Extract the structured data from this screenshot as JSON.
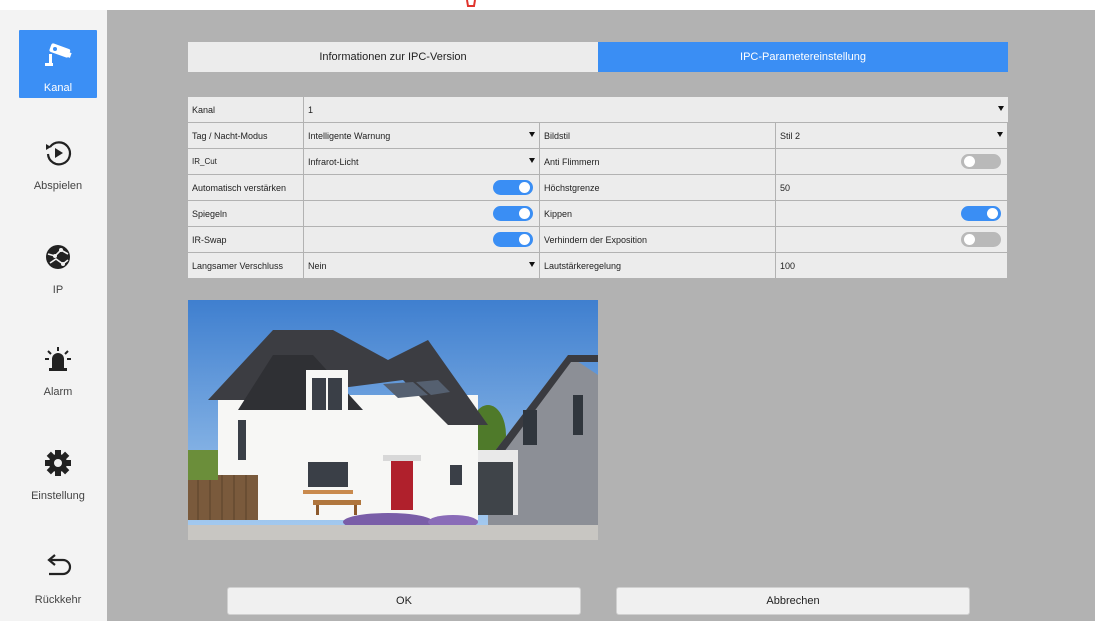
{
  "sidebar": {
    "items": [
      {
        "label": "Kanal",
        "icon": "camera-icon",
        "active": true
      },
      {
        "label": "Abspielen",
        "icon": "replay-icon",
        "active": false
      },
      {
        "label": "IP",
        "icon": "network-globe-icon",
        "active": false
      },
      {
        "label": "Alarm",
        "icon": "alarm-siren-icon",
        "active": false
      },
      {
        "label": "Einstellung",
        "icon": "gear-icon",
        "active": false
      },
      {
        "label": "Rückkehr",
        "icon": "back-arrow-icon",
        "active": false
      }
    ]
  },
  "tabs": [
    {
      "label": "Informationen zur IPC-Version",
      "active": false
    },
    {
      "label": "IPC-Parametereinstellung",
      "active": true
    }
  ],
  "settings": {
    "kanal": {
      "label": "Kanal",
      "value": "1"
    },
    "tag_nacht": {
      "label": "Tag / Nacht-Modus",
      "value": "Intelligente Warnung"
    },
    "bildstil": {
      "label": "Bildstil",
      "value": "Stil 2"
    },
    "ir_cut": {
      "label": "IR_Cut",
      "value": "Infrarot-Licht"
    },
    "anti_flimmern": {
      "label": "Anti Flimmern",
      "on": false
    },
    "auto_verstaerken": {
      "label": "Automatisch verstärken",
      "on": true
    },
    "hoechstgrenze": {
      "label": "Höchstgrenze",
      "value": "50"
    },
    "spiegeln": {
      "label": "Spiegeln",
      "on": true
    },
    "kippen": {
      "label": "Kippen",
      "on": true
    },
    "ir_swap": {
      "label": "IR-Swap",
      "on": true
    },
    "exposition": {
      "label": "Verhindern der Exposition",
      "on": false
    },
    "langsamer_verschluss": {
      "label": "Langsamer Verschluss",
      "value": "Nein"
    },
    "lautstaerke": {
      "label": "Lautstärkeregelung",
      "value": "100"
    }
  },
  "buttons": {
    "ok": "OK",
    "cancel": "Abbrechen"
  },
  "colors": {
    "accent": "#3a8ef4",
    "panel_bg": "#b2b2b2",
    "cell_bg": "#ececec"
  }
}
